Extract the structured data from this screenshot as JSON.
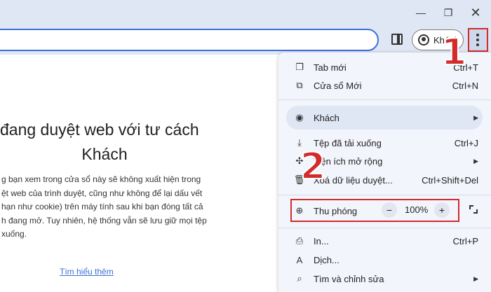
{
  "window_controls": {
    "minimize": "—",
    "maximize": "❐",
    "close": "✕"
  },
  "toolbar": {
    "profile_label": "Khách"
  },
  "page": {
    "heading_line1": "đang duyệt web với tư cách",
    "heading_line2": "Khách",
    "body_lines": [
      "g bạn xem trong cửa sổ này sẽ không xuất hiện trong",
      "ệt web của trình duyệt, cũng như không để lại dấu vết",
      "hạn như cookie) trên máy tính sau khi bạn đóng tất cả",
      "h đang mở. Tuy nhiên, hệ thống vẫn sẽ lưu giữ mọi tệp",
      "xuống."
    ],
    "learn_more": "Tìm hiểu thêm"
  },
  "menu": {
    "new_tab": {
      "label": "Tab mới",
      "shortcut": "Ctrl+T"
    },
    "new_window": {
      "label": "Cửa sổ Mới",
      "shortcut": "Ctrl+N"
    },
    "guest": {
      "label": "Khách"
    },
    "downloads": {
      "label": "Tệp đã tải xuống",
      "shortcut": "Ctrl+J"
    },
    "extensions": {
      "label": "Tiện ích mở rộng"
    },
    "clear_data": {
      "label": "Xoá dữ liệu duyệt...",
      "shortcut": "Ctrl+Shift+Del"
    },
    "zoom": {
      "label": "Thu phóng",
      "minus": "−",
      "value": "100%",
      "plus": "+"
    },
    "print": {
      "label": "In...",
      "shortcut": "Ctrl+P"
    },
    "translate": {
      "label": "Dịch..."
    },
    "find_edit": {
      "label": "Tìm và chỉnh sửa"
    }
  },
  "annotations": {
    "step1": "1",
    "step2": "2"
  },
  "colors": {
    "accent_red": "#d22b2b",
    "link_blue": "#3d6fd6",
    "chrome_bg": "#dfe6f4"
  }
}
